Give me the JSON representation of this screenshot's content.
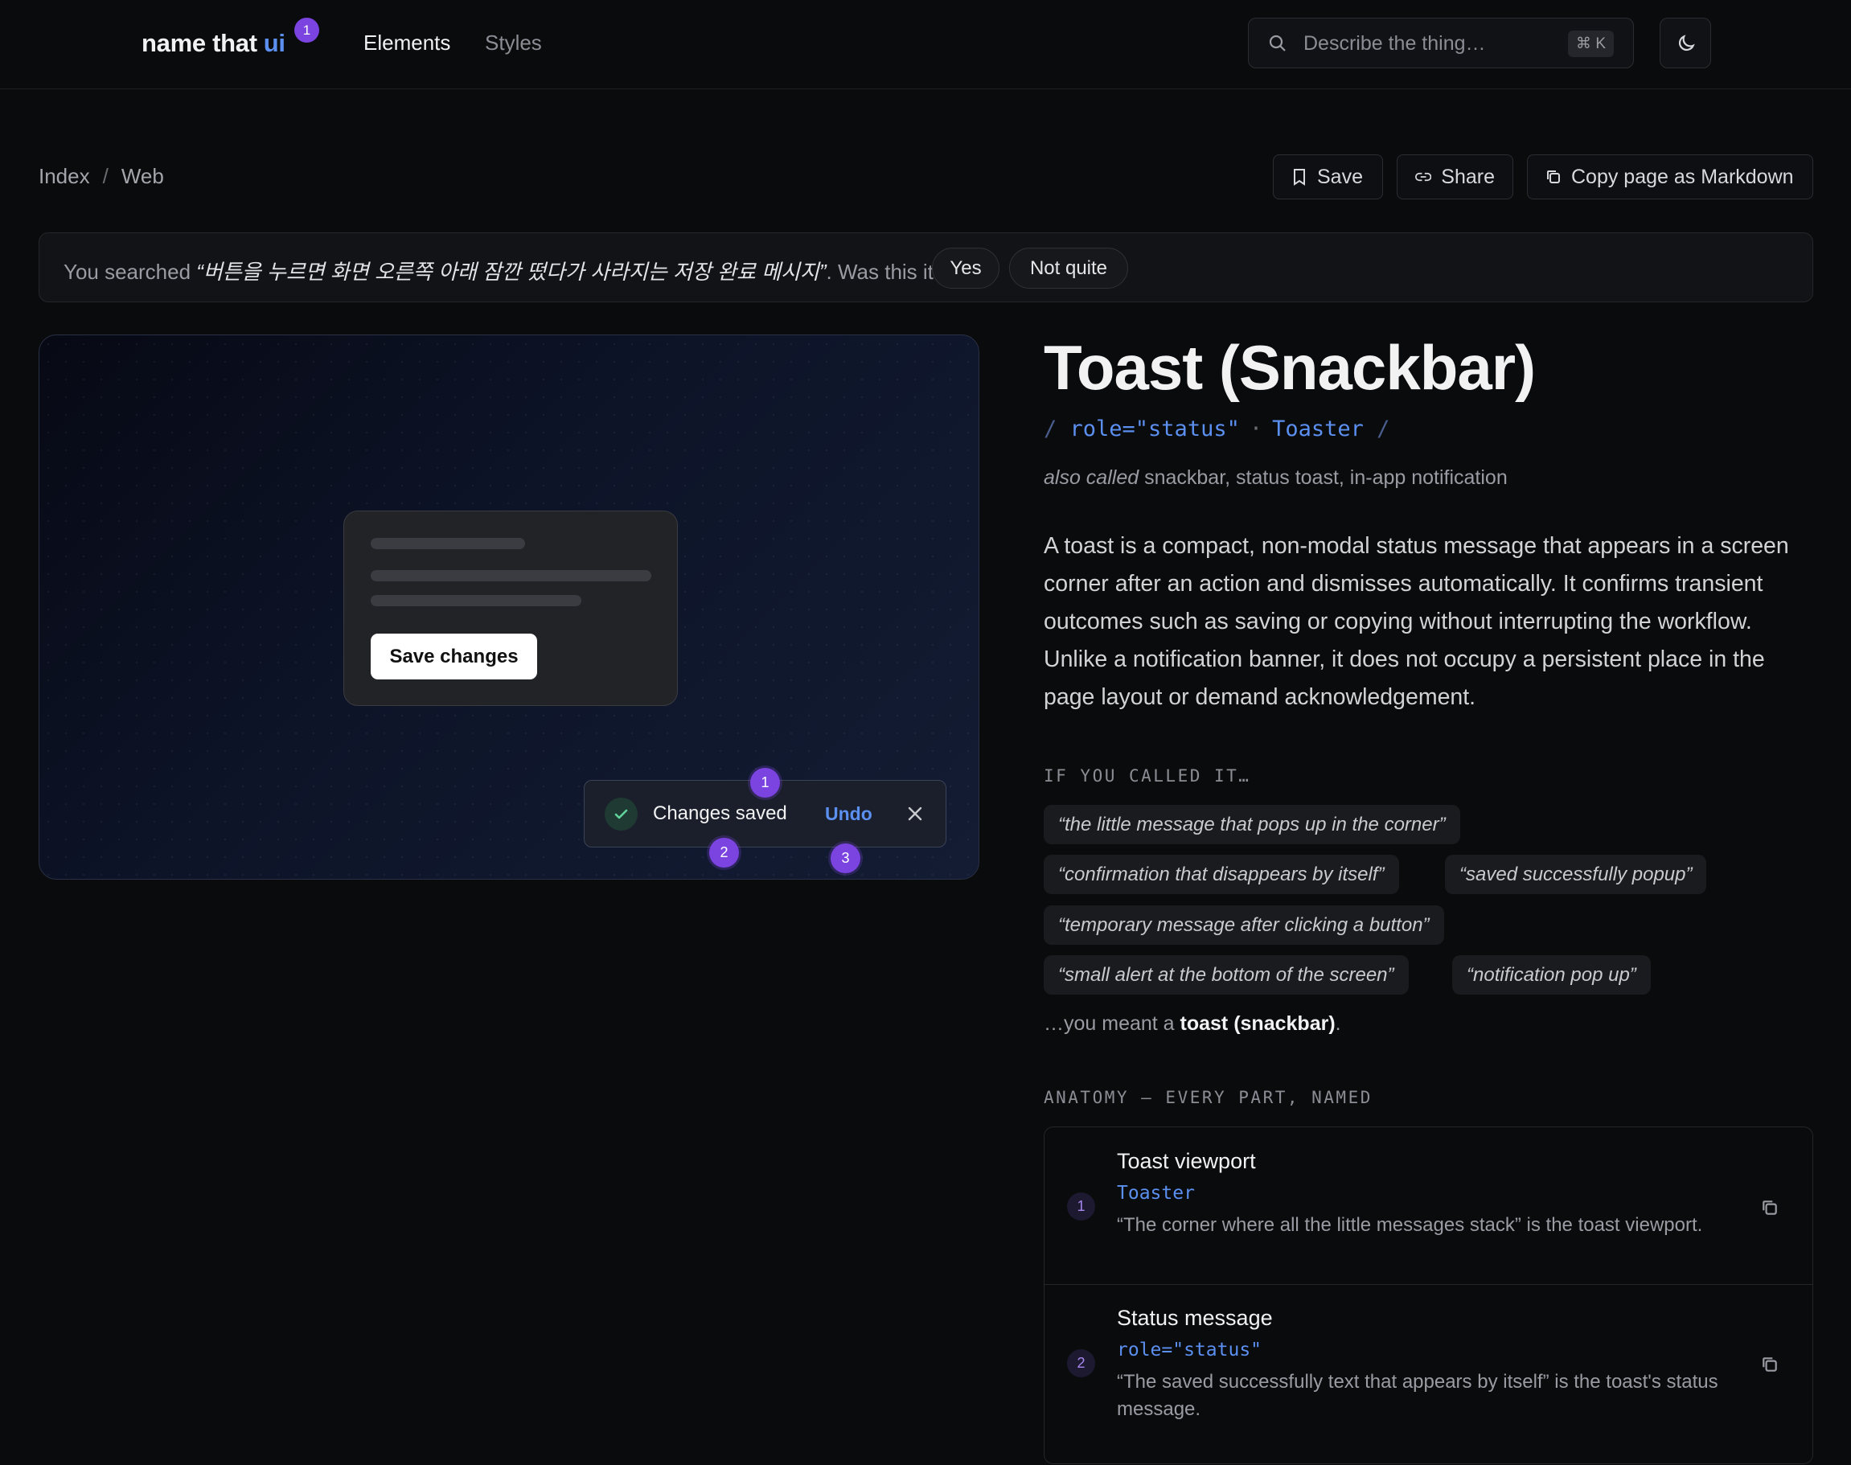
{
  "header": {
    "logo_text": "name that",
    "logo_accent": "ui",
    "logo_badge": "1",
    "nav": [
      "Elements",
      "Styles"
    ],
    "search_placeholder": "Describe the thing…",
    "search_shortcut": "⌘ K"
  },
  "breadcrumb": [
    "Index",
    "Web"
  ],
  "actions": {
    "save": "Save",
    "share": "Share",
    "copy": "Copy page as Markdown"
  },
  "feedback": {
    "prefix": "You searched ",
    "query": "“버튼을 누르면 화면 오른쪽 아래 잠깐 떴다가 사라지는 저장 완료 메시지”",
    "suffix": ". Was this it?",
    "yes": "Yes",
    "no": "Not quite"
  },
  "preview": {
    "button": "Save changes",
    "toast_message": "Changes saved",
    "toast_action": "Undo",
    "pins": [
      "1",
      "2",
      "3"
    ]
  },
  "element": {
    "title": "Toast (Snackbar)",
    "role": "role=\"status\"",
    "component": "Toaster",
    "also_called_label": "also called",
    "also_called": "snackbar, status toast, in-app notification",
    "description": "A toast is a compact, non-modal status message that appears in a screen corner after an action and dismisses automatically. It confirms transient outcomes such as saving or copying without interrupting the workflow. Unlike a notification banner, it does not occupy a persistent place in the page layout or demand acknowledgement."
  },
  "called_it": {
    "label": "IF YOU CALLED IT…",
    "phrases": [
      "“the little message that pops up in the corner”",
      "“confirmation that disappears by itself”",
      "“saved successfully popup”",
      "“temporary message after clicking a button”",
      "“small alert at the bottom of the screen”",
      "“notification pop up”"
    ],
    "meant_prefix": "…you meant a ",
    "meant_term": "toast (snackbar)",
    "meant_suffix": "."
  },
  "anatomy": {
    "label": "ANATOMY — EVERY PART, NAMED",
    "parts": [
      {
        "num": "1",
        "name": "Toast viewport",
        "code": "Toaster",
        "note": "“The corner where all the little messages stack” is the toast viewport."
      },
      {
        "num": "2",
        "name": "Status message",
        "code": "role=\"status\"",
        "note": "“The saved successfully text that appears by itself” is the toast's status message."
      }
    ]
  },
  "colors": {
    "accent": "#5b8ff0",
    "badge": "#7b44e0",
    "background": "#0a0b0d"
  },
  "icons": [
    "search-icon",
    "moon-icon",
    "bookmark-icon",
    "link-icon",
    "copy-icon",
    "check-icon",
    "close-icon"
  ]
}
